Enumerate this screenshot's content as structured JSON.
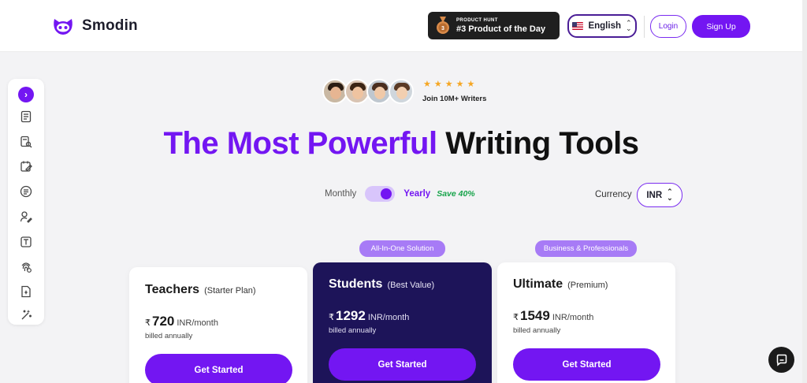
{
  "brand": {
    "name": "Smodin",
    "accent": "#7316f2"
  },
  "header": {
    "badge_small": "PRODUCT HUNT",
    "badge_big": "#3 Product of the Day",
    "language": "English",
    "login": "Login",
    "signup": "Sign Up"
  },
  "sidebar": {
    "items": [
      "chevron-right-icon",
      "document-icon",
      "document-search-icon",
      "edit-calendar-icon",
      "document-lines-icon",
      "user-pen-icon",
      "text-box-icon",
      "fingerprint-icon",
      "file-ai-icon",
      "magic-wand-icon"
    ]
  },
  "hero": {
    "rating_stars": 5,
    "join_text": "Join 10M+ Writers",
    "headline_accent": "The Most Powerful",
    "headline_rest": "Writing Tools"
  },
  "billing": {
    "monthly": "Monthly",
    "yearly": "Yearly",
    "save": "Save 40%",
    "selected": "Yearly",
    "currency_label": "Currency",
    "currency": "INR"
  },
  "plans": [
    {
      "name": "Teachers",
      "sub": "(Starter Plan)",
      "currency_symbol": "₹",
      "price": "720",
      "period": "INR/month",
      "billed": "billed annually",
      "cta": "Get Started",
      "tag": ""
    },
    {
      "name": "Students",
      "sub": "(Best Value)",
      "currency_symbol": "₹",
      "price": "1292",
      "period": "INR/month",
      "billed": "billed annually",
      "cta": "Get Started",
      "tag": "All-In-One Solution"
    },
    {
      "name": "Ultimate",
      "sub": "(Premium)",
      "currency_symbol": "₹",
      "price": "1549",
      "period": "INR/month",
      "billed": "billed annually",
      "cta": "Get Started",
      "tag": "Business & Professionals"
    }
  ]
}
